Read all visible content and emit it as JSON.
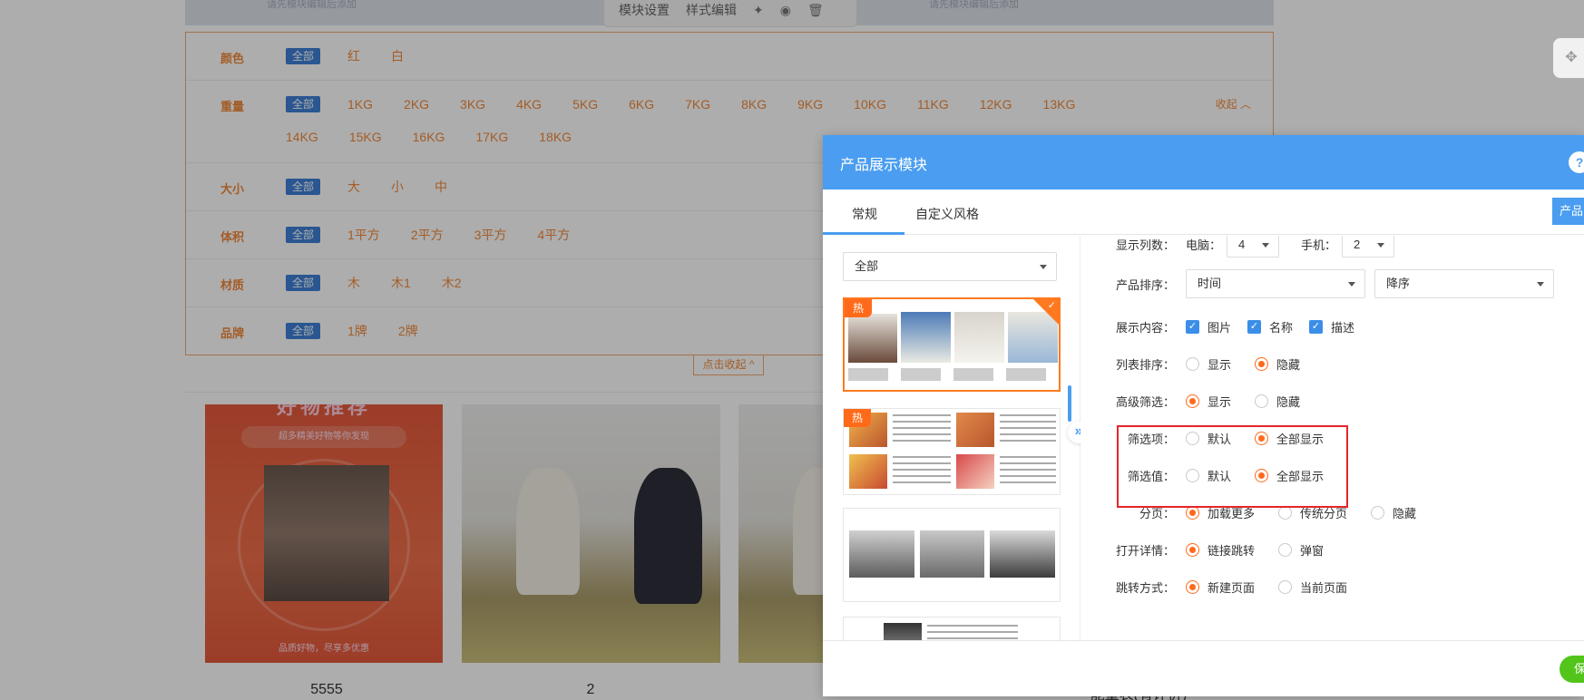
{
  "page": {
    "top_hint_left": "请先模块编辑后添加",
    "top_hint_right": "请先模块编辑后添加",
    "toolbar": {
      "module_settings": "模块设置",
      "style_edit": "样式编辑"
    },
    "filters": [
      {
        "label": "颜色",
        "options": [
          "全部",
          "红",
          "白"
        ]
      },
      {
        "label": "重量",
        "options": [
          "全部",
          "1KG",
          "2KG",
          "3KG",
          "4KG",
          "5KG",
          "6KG",
          "7KG",
          "8KG",
          "9KG",
          "10KG",
          "11KG",
          "12KG",
          "13KG",
          "14KG",
          "15KG",
          "16KG",
          "17KG",
          "18KG"
        ],
        "collapse": "收起"
      },
      {
        "label": "大小",
        "options": [
          "全部",
          "大",
          "小",
          "中"
        ]
      },
      {
        "label": "体积",
        "options": [
          "全部",
          "1平方",
          "2平方",
          "3平方",
          "4平方"
        ]
      },
      {
        "label": "材质",
        "options": [
          "全部",
          "木",
          "木1",
          "木2"
        ]
      },
      {
        "label": "品牌",
        "options": [
          "全部",
          "1牌",
          "2牌"
        ]
      }
    ],
    "collapse_all": "点击收起 ^",
    "products": [
      {
        "name": "5555",
        "poster_title": "好物推荐",
        "poster_sub": "超多精美好物等你发现",
        "poster_foot": "品质好物，尽享多优惠"
      },
      {
        "name": "2"
      },
      {
        "name": "能量表(有评价)"
      }
    ]
  },
  "dialog": {
    "title": "产品展示模块",
    "help": "?",
    "tabs": [
      "常规",
      "自定义风格"
    ],
    "right_tab": "产品",
    "template_select": "全部",
    "hot_badge": "热",
    "settings": {
      "columns": {
        "label": "显示列数：",
        "pc_label": "电脑：",
        "pc_value": "4",
        "mobile_label": "手机：",
        "mobile_value": "2"
      },
      "sort": {
        "label": "产品排序：",
        "field": "时间",
        "order": "降序"
      },
      "content": {
        "label": "展示内容：",
        "items": [
          "图片",
          "名称",
          "描述"
        ]
      },
      "list_sort": {
        "label": "列表排序：",
        "options": [
          "显示",
          "隐藏"
        ],
        "selected": 1
      },
      "adv_filter": {
        "label": "高级筛选：",
        "options": [
          "显示",
          "隐藏"
        ],
        "selected": 0
      },
      "filter_items": {
        "label": "筛选项：",
        "options": [
          "默认",
          "全部显示"
        ],
        "selected": 1
      },
      "filter_values": {
        "label": "筛选值：",
        "options": [
          "默认",
          "全部显示"
        ],
        "selected": 1
      },
      "paging": {
        "label": "分页：",
        "options": [
          "加载更多",
          "传统分页",
          "隐藏"
        ],
        "selected": 0
      },
      "open_detail": {
        "label": "打开详情：",
        "options": [
          "链接跳转",
          "弹窗"
        ],
        "selected": 0
      },
      "jump_mode": {
        "label": "跳转方式：",
        "options": [
          "新建页面",
          "当前页面"
        ],
        "selected": 0
      }
    },
    "save": "保存"
  },
  "colors": {
    "accent_blue": "#4a9df0",
    "accent_orange": "#ff6a1a",
    "highlight_red": "#e5252a",
    "save_green": "#52c41a"
  }
}
